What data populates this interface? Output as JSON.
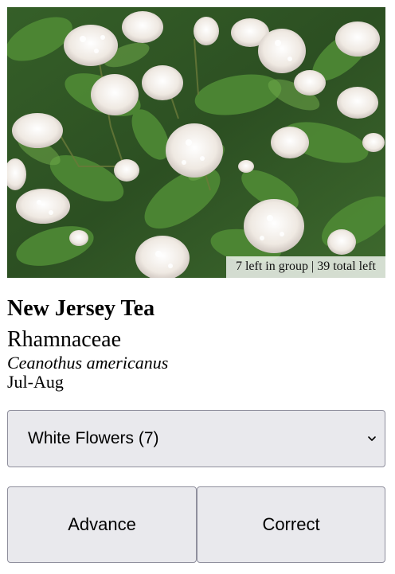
{
  "photo": {
    "subject": "white flower clusters among green leaves",
    "counter_text": "7 left in group | 39 total left"
  },
  "plant": {
    "common_name": "New Jersey Tea",
    "family": "Rhamnaceae",
    "scientific_name": "Ceanothus americanus",
    "bloom_months": "Jul-Aug"
  },
  "group_select": {
    "selected": "White Flowers (7)"
  },
  "buttons": {
    "advance": "Advance",
    "correct": "Correct"
  },
  "colors": {
    "leaf_dark": "#2f5a23",
    "leaf": "#4f8a35",
    "flower": "#f4f1ec",
    "button_bg": "#e9e9ed"
  },
  "icons": {
    "select_arrow": "chevron-down-icon"
  }
}
